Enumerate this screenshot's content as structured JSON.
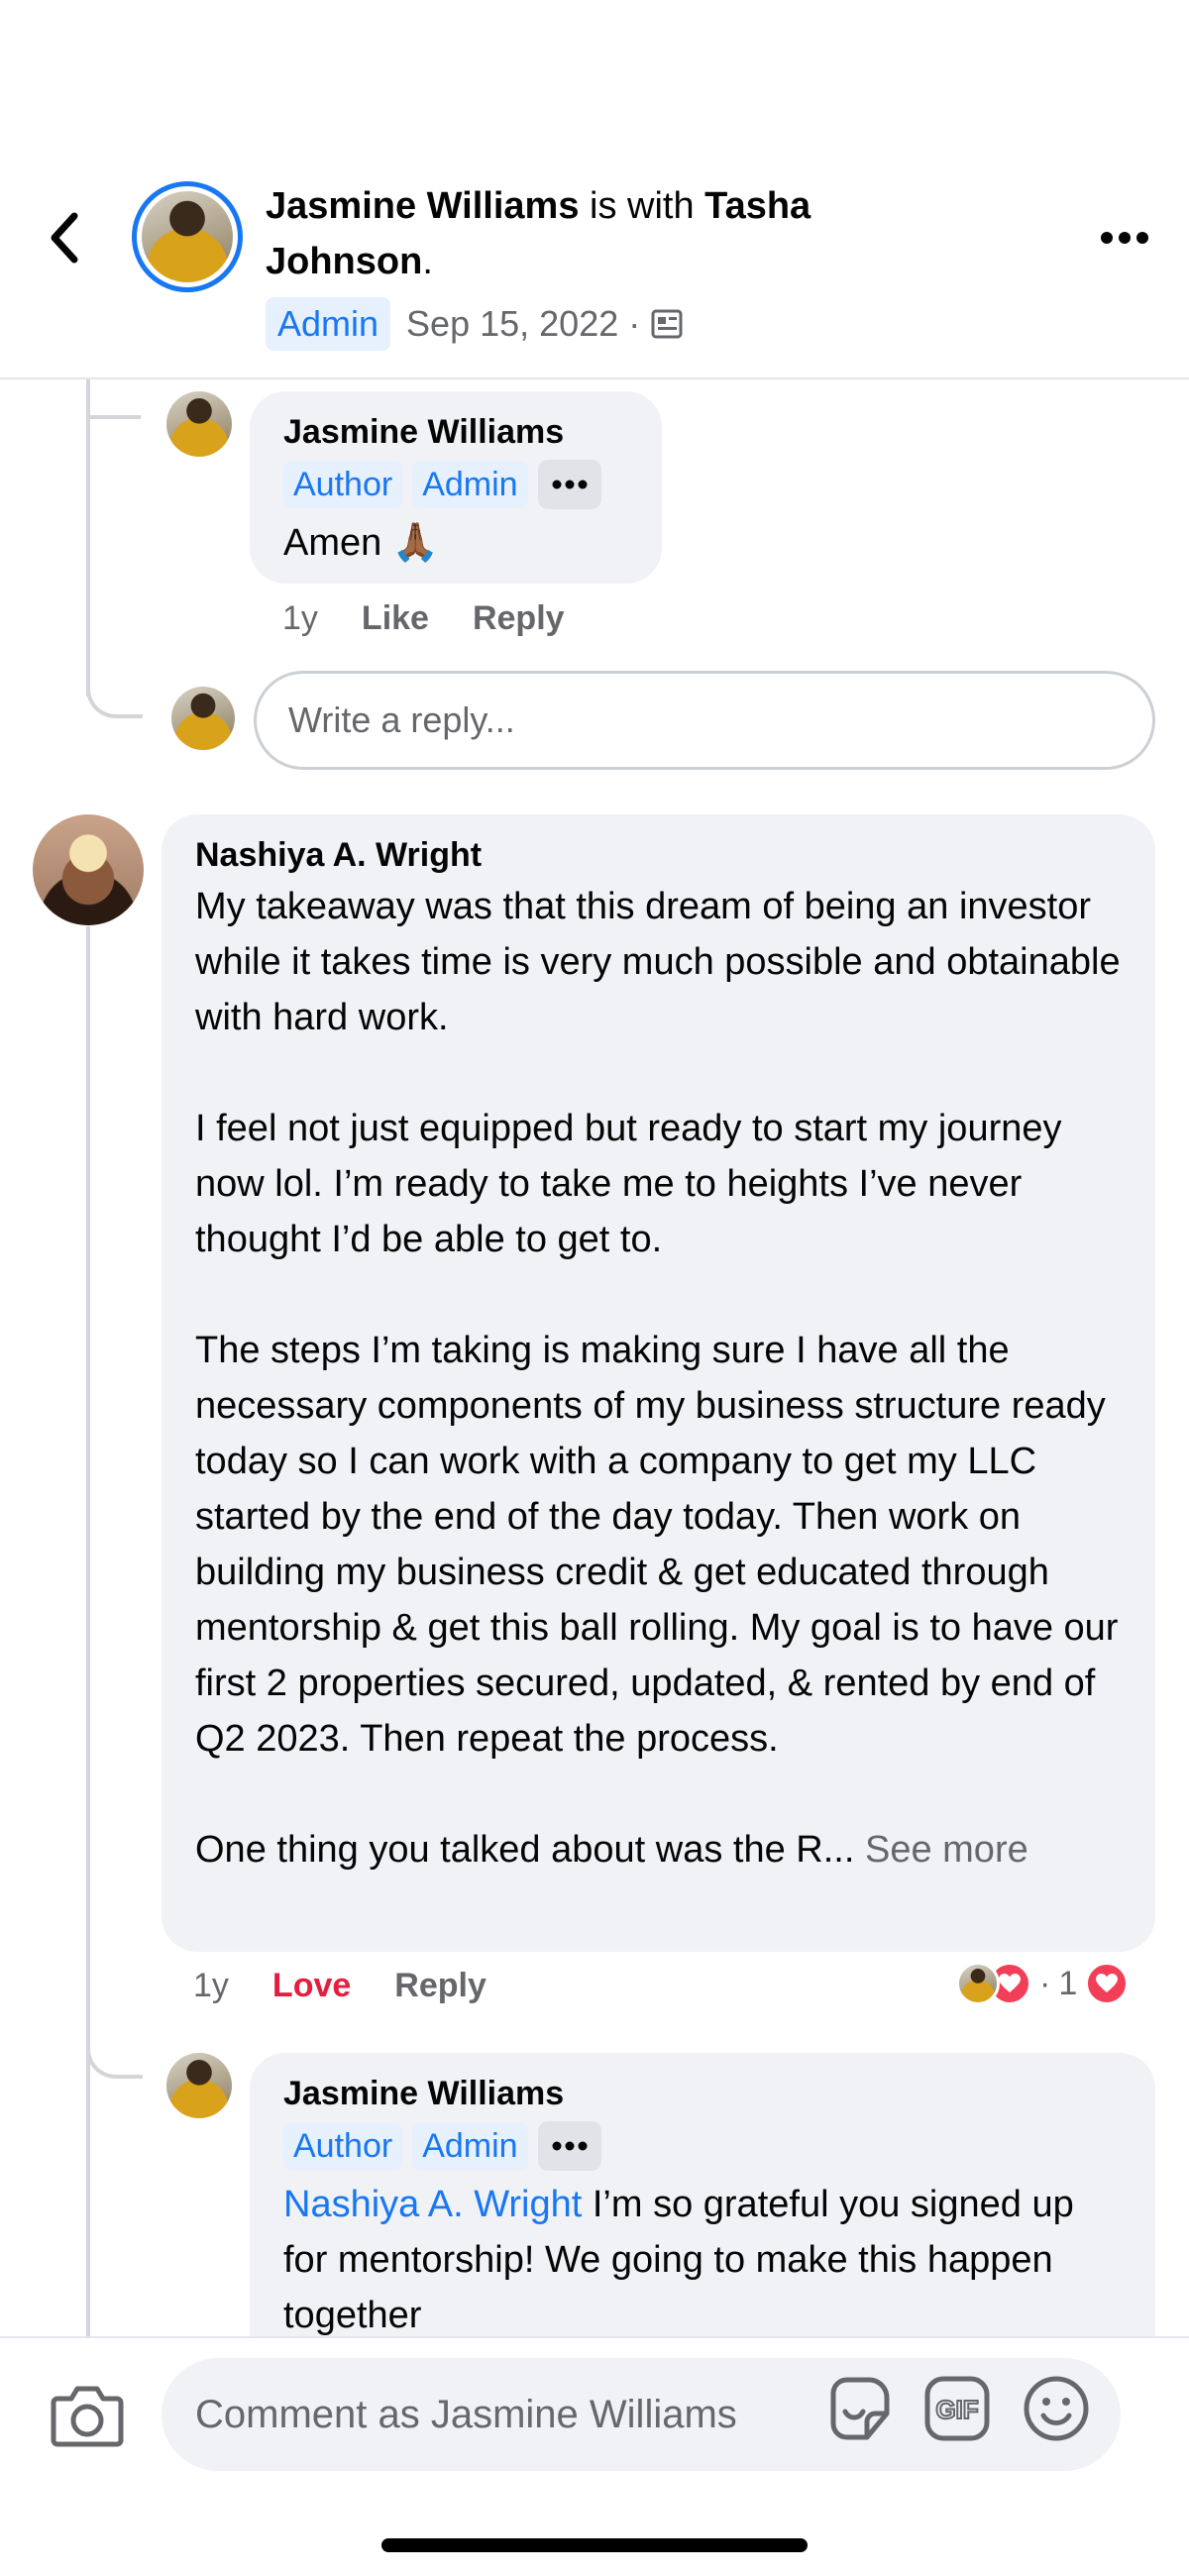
{
  "header": {
    "author": "Jasmine Williams",
    "with_text": " is with ",
    "tagged": "Tasha Johnson",
    "period": ".",
    "badge": "Admin",
    "date": "Sep 15, 2022",
    "separator": "·"
  },
  "reply1": {
    "author": "Jasmine Williams",
    "roles": [
      "Author",
      "Admin"
    ],
    "text": "Amen 🙏🏾",
    "time": "1y",
    "like": "Like",
    "reply": "Reply"
  },
  "reply_box": {
    "placeholder": "Write a reply..."
  },
  "comment": {
    "author": "Nashiya A. Wright",
    "text": "My takeaway was that this dream of being an investor while it takes time is very much possible and obtainable with hard work.\n\nI feel not just equipped but ready to start my journey now lol. I’m ready to take me to heights I’ve never thought I’d be able to get to.\n\nThe steps I’m taking is making sure I have all the necessary components of my business structure ready today so I can work with a company to get my LLC started by the end of the day today. Then work on building my business credit & get educated through mentorship & get this ball rolling. My goal is to have our first 2 properties secured, updated, & rented by end of Q2 2023. Then repeat the process.\n\nOne thing you talked about was the R...",
    "see_more": " See more",
    "time": "1y",
    "love": "Love",
    "reply": "Reply",
    "reaction_sep": "·",
    "reaction_count": "1"
  },
  "reply2": {
    "author": "Jasmine Williams",
    "roles": [
      "Author",
      "Admin"
    ],
    "mention": "Nashiya A. Wright",
    "text": " I’m so grateful you signed up for mentorship! We going to make this happen together"
  },
  "composer": {
    "placeholder": "Comment as Jasmine Williams"
  },
  "colors": {
    "accent": "#1877f2",
    "love": "#e41e3f",
    "bubble": "#f0f2f5"
  },
  "icons": [
    "back-icon",
    "more-icon",
    "privacy-icon",
    "camera-icon",
    "sticker-icon",
    "gif-icon",
    "emoji-icon",
    "heart-icon"
  ]
}
